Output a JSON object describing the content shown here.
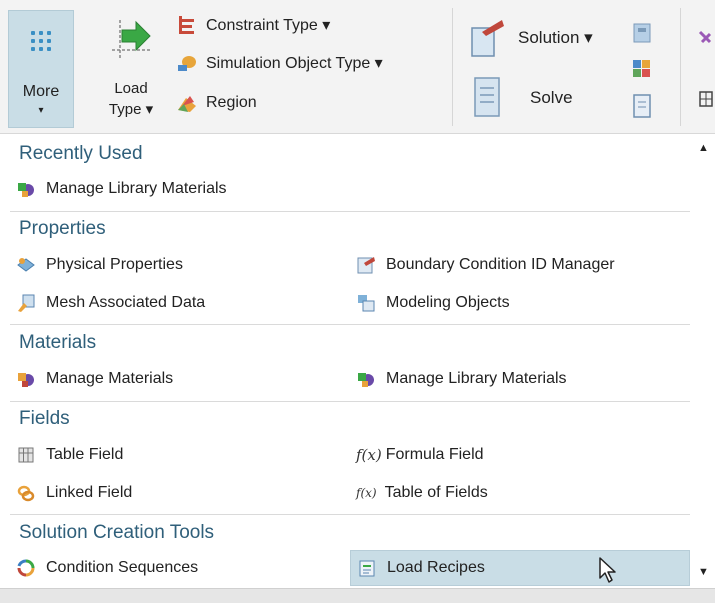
{
  "ribbon": {
    "more": {
      "label": "More",
      "caret": "▾",
      "icon": "grid-icon"
    },
    "load_type": {
      "label_line1": "Load",
      "label_line2": "Type ▾",
      "icon": "load-arrow-icon"
    },
    "constraint_type": {
      "label": "Constraint Type ▾",
      "icon": "constraint-icon"
    },
    "simulation_object_type": {
      "label": "Simulation Object Type ▾",
      "icon": "simulation-object-icon"
    },
    "region": {
      "label": "Region",
      "icon": "region-icon"
    },
    "solution": {
      "label": "Solution ▾",
      "icon": "solution-icon"
    },
    "solve": {
      "label": "Solve",
      "icon": "solve-icon"
    }
  },
  "menu": {
    "sections": [
      {
        "title": "Recently Used",
        "items": [
          {
            "label": "Manage Library Materials",
            "icon": "library-materials-icon"
          }
        ]
      },
      {
        "title": "Properties",
        "items": [
          {
            "label": "Physical Properties",
            "icon": "physical-properties-icon"
          },
          {
            "label": "Boundary Condition ID Manager",
            "icon": "bc-id-manager-icon"
          },
          {
            "label": "Mesh Associated Data",
            "icon": "mesh-data-icon"
          },
          {
            "label": "Modeling Objects",
            "icon": "modeling-objects-icon"
          }
        ]
      },
      {
        "title": "Materials",
        "items": [
          {
            "label": "Manage Materials",
            "icon": "materials-icon"
          },
          {
            "label": "Manage Library Materials",
            "icon": "library-materials-icon"
          }
        ]
      },
      {
        "title": "Fields",
        "items": [
          {
            "label": "Table Field",
            "icon": "table-field-icon"
          },
          {
            "label": "Formula Field",
            "icon": "formula-field-icon",
            "glyph": "f(x)"
          },
          {
            "label": "Linked Field",
            "icon": "linked-field-icon"
          },
          {
            "label": "Table of Fields",
            "icon": "table-of-fields-icon",
            "glyph": "f(x)"
          }
        ]
      },
      {
        "title": "Solution Creation Tools",
        "items": [
          {
            "label": "Condition Sequences",
            "icon": "condition-sequences-icon"
          },
          {
            "label": "Load Recipes",
            "icon": "load-recipes-icon",
            "highlighted": true
          }
        ]
      }
    ]
  },
  "colors": {
    "accent_highlight": "#c9dde6",
    "section_title": "#2f5f7a",
    "ribbon_bg": "#f3f3f3"
  }
}
